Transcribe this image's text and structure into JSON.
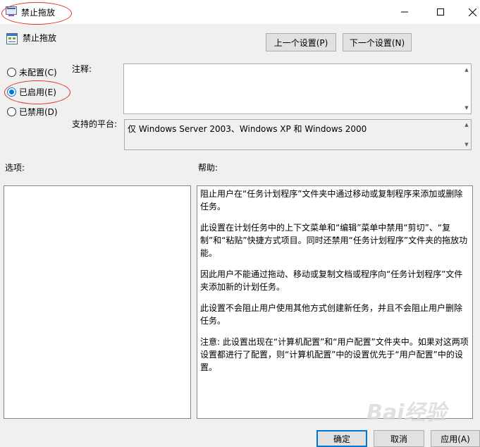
{
  "window": {
    "title": "禁止拖放",
    "minimize_icon": "minimize-icon",
    "maximize_icon": "maximize-icon",
    "close_icon": "close-icon"
  },
  "header": {
    "policy_name": "禁止拖放",
    "prev_button": "上一个设置(P)",
    "next_button": "下一个设置(N)"
  },
  "state": {
    "options": [
      {
        "label": "未配置(C)",
        "checked": false
      },
      {
        "label": "已启用(E)",
        "checked": true
      },
      {
        "label": "已禁用(D)",
        "checked": false
      }
    ]
  },
  "comment": {
    "label": "注释:",
    "value": ""
  },
  "platform": {
    "label": "支持的平台:",
    "value": "仅 Windows Server 2003、Windows XP 和 Windows 2000"
  },
  "options_section": {
    "label": "选项:"
  },
  "help_section": {
    "label": "帮助:",
    "paragraphs": [
      "阻止用户在“任务计划程序”文件夹中通过移动或复制程序来添加或删除任务。",
      "此设置在计划任务中的上下文菜单和“编辑”菜单中禁用“剪切”、“复制”和“粘贴”快捷方式项目。同时还禁用“任务计划程序”文件夹的拖放功能。",
      "因此用户不能通过拖动、移动或复制文档或程序向“任务计划程序”文件夹添加新的计划任务。",
      "此设置不会阻止用户使用其他方式创建新任务，并且不会阻止用户删除任务。",
      "注意: 此设置出现在“计算机配置”和“用户配置”文件夹中。如果对这两项设置都进行了配置，则“计算机配置”中的设置优先于“用户配置”中的设置。"
    ]
  },
  "footer": {
    "ok": "确定",
    "cancel": "取消",
    "apply": "应用(A)"
  },
  "watermark": "Bai经验",
  "colors": {
    "accent": "#0078d7",
    "annotation": "#e0322d"
  }
}
